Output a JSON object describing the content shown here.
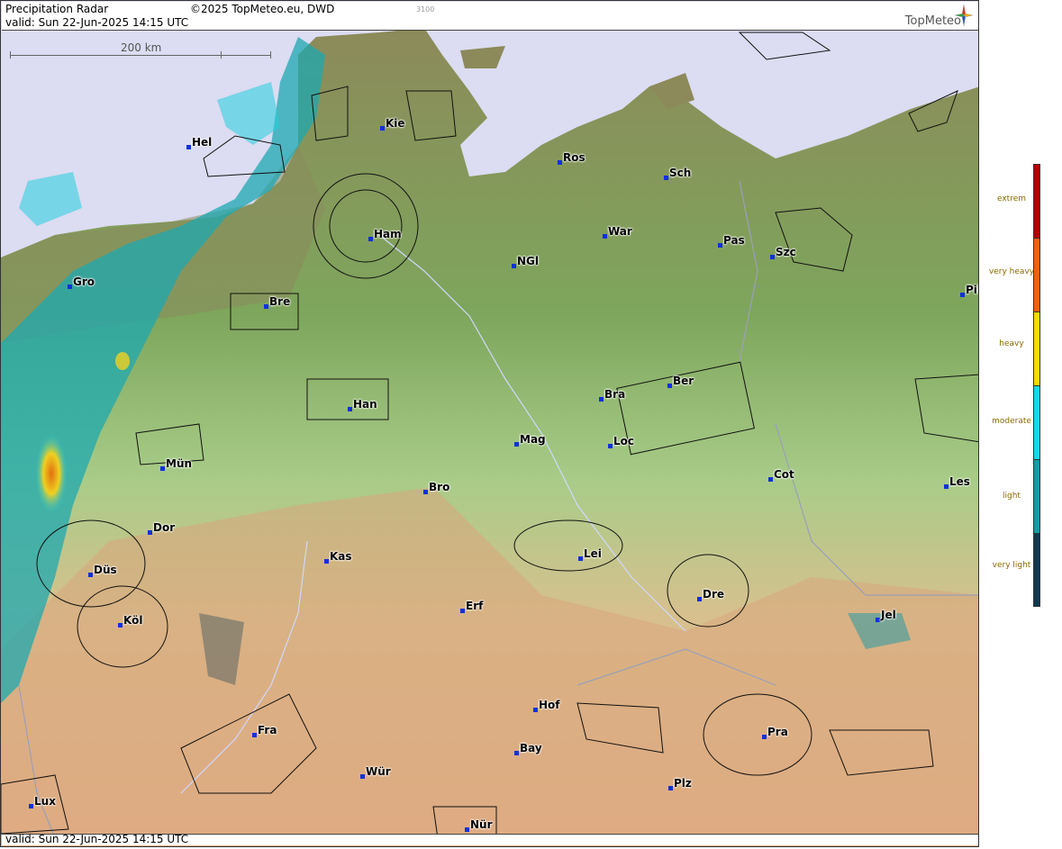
{
  "header": {
    "title": "Precipitation Radar",
    "copyright": "©2025 TopMeteo.eu, DWD",
    "code": "3100",
    "valid": "valid:  Sun  22-Jun-2025 14:15 UTC",
    "logo": "TopMeteo"
  },
  "footer": {
    "valid": "valid:  Sun  22-Jun-2025 14:15 UTC"
  },
  "scale": {
    "label": "200 km"
  },
  "cities": [
    {
      "id": "hel",
      "label": "Hel"
    },
    {
      "id": "kie",
      "label": "Kie"
    },
    {
      "id": "ros",
      "label": "Ros"
    },
    {
      "id": "sch",
      "label": "Sch"
    },
    {
      "id": "ham",
      "label": "Ham"
    },
    {
      "id": "war",
      "label": "War"
    },
    {
      "id": "pas",
      "label": "Pas"
    },
    {
      "id": "szc",
      "label": "Szc"
    },
    {
      "id": "ngl",
      "label": "NGl"
    },
    {
      "id": "gro",
      "label": "Gro"
    },
    {
      "id": "bre",
      "label": "Bre"
    },
    {
      "id": "pil",
      "label": "Pil"
    },
    {
      "id": "ber",
      "label": "Ber"
    },
    {
      "id": "bra",
      "label": "Bra"
    },
    {
      "id": "han",
      "label": "Han"
    },
    {
      "id": "mag",
      "label": "Mag"
    },
    {
      "id": "loc",
      "label": "Loc"
    },
    {
      "id": "mun",
      "label": "Mün"
    },
    {
      "id": "cot",
      "label": "Cot"
    },
    {
      "id": "les",
      "label": "Les"
    },
    {
      "id": "bro",
      "label": "Bro"
    },
    {
      "id": "dor",
      "label": "Dor"
    },
    {
      "id": "kas",
      "label": "Kas"
    },
    {
      "id": "lei",
      "label": "Lei"
    },
    {
      "id": "dus",
      "label": "Düs"
    },
    {
      "id": "dre",
      "label": "Dre"
    },
    {
      "id": "erf",
      "label": "Erf"
    },
    {
      "id": "kol",
      "label": "Köl"
    },
    {
      "id": "jel",
      "label": "Jel"
    },
    {
      "id": "hof",
      "label": "Hof"
    },
    {
      "id": "fra",
      "label": "Fra"
    },
    {
      "id": "pra",
      "label": "Pra"
    },
    {
      "id": "bay",
      "label": "Bay"
    },
    {
      "id": "wur",
      "label": "Wür"
    },
    {
      "id": "plz",
      "label": "Plz"
    },
    {
      "id": "lux",
      "label": "Lux"
    },
    {
      "id": "nur",
      "label": "Nür"
    }
  ],
  "legend": [
    {
      "label": "extrem",
      "color": "#b00000"
    },
    {
      "label": "very heavy",
      "color": "#f06010"
    },
    {
      "label": "heavy",
      "color": "#ffd800"
    },
    {
      "label": "moderate",
      "color": "#18d8e8"
    },
    {
      "label": "light",
      "color": "#1898a8"
    },
    {
      "label": "very light",
      "color": "#103850"
    }
  ]
}
